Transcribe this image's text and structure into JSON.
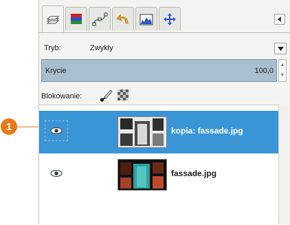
{
  "mode": {
    "label": "Tryb:",
    "value": "Zwykły"
  },
  "opacity": {
    "label": "Krycie",
    "value": "100,0"
  },
  "lock": {
    "label": "Blokowanie:"
  },
  "layers": [
    {
      "name": "kopia: fassade.jpg",
      "visible": true,
      "selected": true
    },
    {
      "name": "fassade.jpg",
      "visible": true,
      "selected": false
    }
  ],
  "callout": {
    "number": "1"
  },
  "tabs": [
    {
      "icon": "layers-icon",
      "active": true
    },
    {
      "icon": "channels-icon",
      "active": false
    },
    {
      "icon": "paths-icon",
      "active": false
    },
    {
      "icon": "undo-history-icon",
      "active": false
    },
    {
      "icon": "histogram-icon",
      "active": false
    },
    {
      "icon": "pointer-move-icon",
      "active": false
    }
  ],
  "colors": {
    "selection": "#3a95d6",
    "opacity_bar": "#a9bfcf",
    "callout": "#e97a17"
  }
}
